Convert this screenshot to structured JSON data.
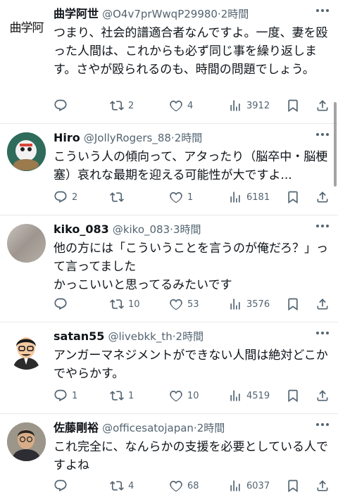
{
  "tweets": [
    {
      "display_name": "曲学阿世",
      "handle": "@O4v7prWwqP29980",
      "dot": "·",
      "time": "2時間",
      "avatar_text": "曲学阿",
      "text": "つまり、社会的譜適合者なんですよ。一度、妻を殴った人間は、これからも必ず同じ事を繰り返します。さやが殴られるのも、時間の問題でしょう。",
      "replies": "",
      "retweets": "2",
      "likes": "4",
      "views": "3912"
    },
    {
      "display_name": "Hiro",
      "handle": "@JollyRogers_88",
      "dot": "·",
      "time": "2時間",
      "text": "こういう人の傾向って、アタったり（脳卒中・脳梗塞）哀れな最期を迎える可能性が大ですよ...",
      "replies": "2",
      "retweets": "",
      "likes": "1",
      "views": "6181"
    },
    {
      "display_name": "kiko_083",
      "handle": "@kiko_083",
      "dot": "·",
      "time": "3時間",
      "text": "他の方には「こういうことを言うのが俺だろ？」って言ってました\nかっこいいと思ってるみたいです",
      "replies": "",
      "retweets": "10",
      "likes": "53",
      "views": "3576"
    },
    {
      "display_name": "satan55",
      "handle": "@livebkk_th",
      "dot": "·",
      "time": "2時間",
      "text": "アンガーマネジメントができない人間は絶対どこかでやらかす。",
      "replies": "1",
      "retweets": "1",
      "likes": "10",
      "views": "4519"
    },
    {
      "display_name": "佐藤剛裕",
      "handle": "@officesatojapan",
      "dot": "·",
      "time": "2時間",
      "text": "これ完全に、なんらかの支援を必要としている人ですよね",
      "replies": "",
      "retweets": "4",
      "likes": "68",
      "views": "6037"
    }
  ],
  "colors": {
    "text": "#0f1419",
    "secondary": "#536471",
    "divider": "#e6e9ec"
  },
  "icons": [
    "reply-icon",
    "retweet-icon",
    "like-icon",
    "views-icon",
    "bookmark-icon",
    "share-icon",
    "more-icon"
  ]
}
